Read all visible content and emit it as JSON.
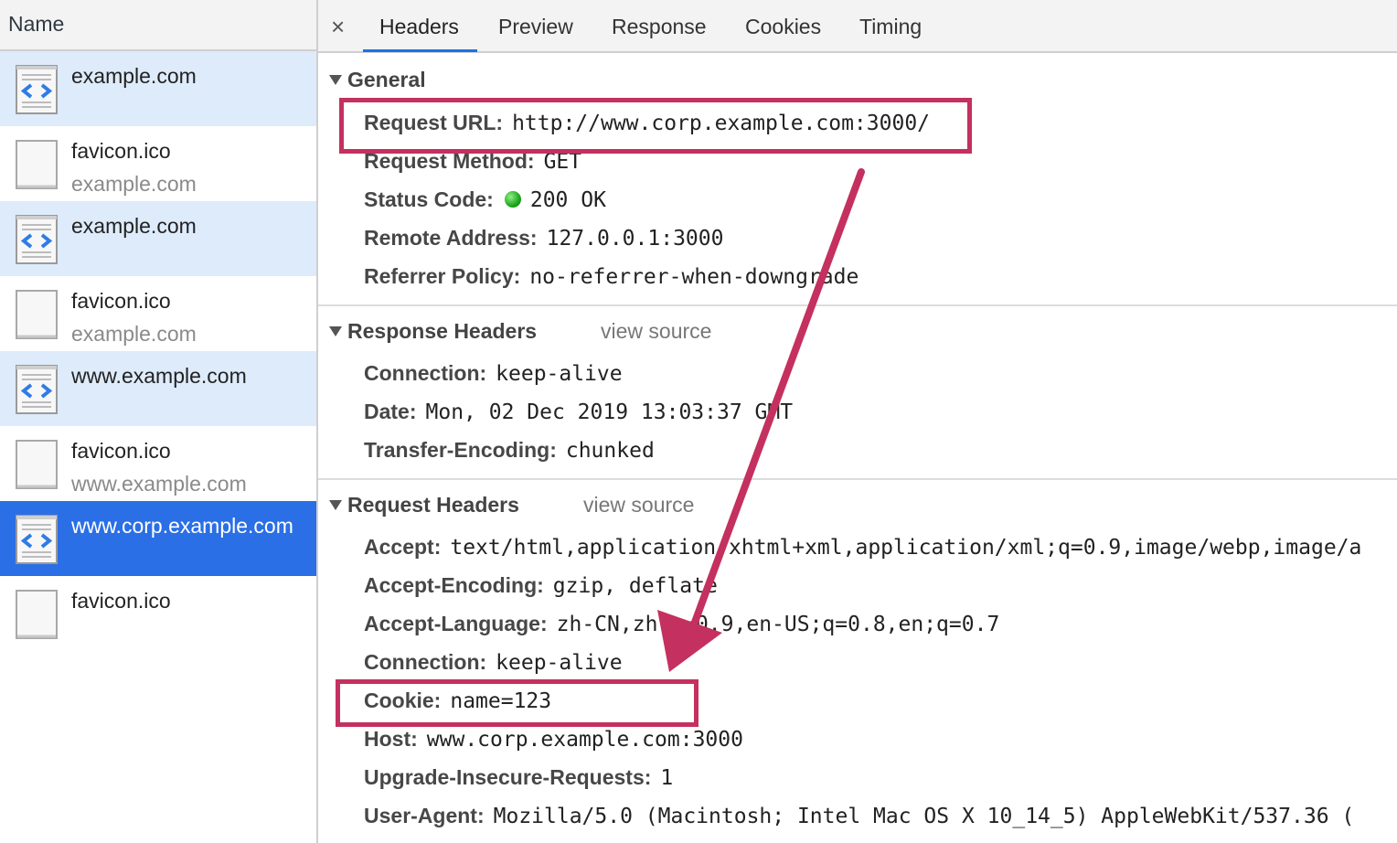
{
  "left_panel": {
    "header": "Name",
    "requests": [
      {
        "name": "example.com",
        "domain": "",
        "type": "document"
      },
      {
        "name": "favicon.ico",
        "domain": "example.com",
        "type": "image"
      },
      {
        "name": "example.com",
        "domain": "",
        "type": "document"
      },
      {
        "name": "favicon.ico",
        "domain": "example.com",
        "type": "image"
      },
      {
        "name": "www.example.com",
        "domain": "",
        "type": "document"
      },
      {
        "name": "favicon.ico",
        "domain": "www.example.com",
        "type": "image"
      },
      {
        "name": "www.corp.example.com",
        "domain": "",
        "type": "document",
        "selected": true
      },
      {
        "name": "favicon.ico",
        "domain": "",
        "type": "image"
      }
    ]
  },
  "tabs": {
    "close": "×",
    "items": [
      "Headers",
      "Preview",
      "Response",
      "Cookies",
      "Timing"
    ],
    "active": "Headers"
  },
  "general": {
    "title": "General",
    "rows": [
      {
        "key": "Request URL:",
        "value": "http://www.corp.example.com:3000/"
      },
      {
        "key": "Request Method:",
        "value": "GET"
      },
      {
        "key": "Status Code:",
        "value": "200 OK"
      },
      {
        "key": "Remote Address:",
        "value": "127.0.0.1:3000"
      },
      {
        "key": "Referrer Policy:",
        "value": "no-referrer-when-downgrade"
      }
    ]
  },
  "response_headers": {
    "title": "Response Headers",
    "view_source": "view source",
    "rows": [
      {
        "key": "Connection:",
        "value": "keep-alive"
      },
      {
        "key": "Date:",
        "value": "Mon, 02 Dec 2019 13:03:37 GMT"
      },
      {
        "key": "Transfer-Encoding:",
        "value": "chunked"
      }
    ]
  },
  "request_headers": {
    "title": "Request Headers",
    "view_source": "view source",
    "rows": [
      {
        "key": "Accept:",
        "value": "text/html,application/xhtml+xml,application/xml;q=0.9,image/webp,image/a"
      },
      {
        "key": "Accept-Encoding:",
        "value": "gzip, deflate"
      },
      {
        "key": "Accept-Language:",
        "value": "zh-CN,zh;q=0.9,en-US;q=0.8,en;q=0.7"
      },
      {
        "key": "Connection:",
        "value": "keep-alive"
      },
      {
        "key": "Cookie:",
        "value": "name=123"
      },
      {
        "key": "Host:",
        "value": "www.corp.example.com:3000"
      },
      {
        "key": "Upgrade-Insecure-Requests:",
        "value": "1"
      },
      {
        "key": "User-Agent:",
        "value": "Mozilla/5.0 (Macintosh; Intel Mac OS X 10_14_5) AppleWebKit/537.36 ("
      }
    ]
  },
  "colors": {
    "annotation": "#c4305f",
    "selected_row": "#2a6fe6",
    "document_row": "#ddebfb",
    "status_ok": "#1ea61a"
  },
  "icons": {
    "document": "html-document-icon",
    "image": "blank-file-icon",
    "status": "status-green-dot-icon",
    "collapse": "triangle-down-icon",
    "close": "close-icon"
  }
}
